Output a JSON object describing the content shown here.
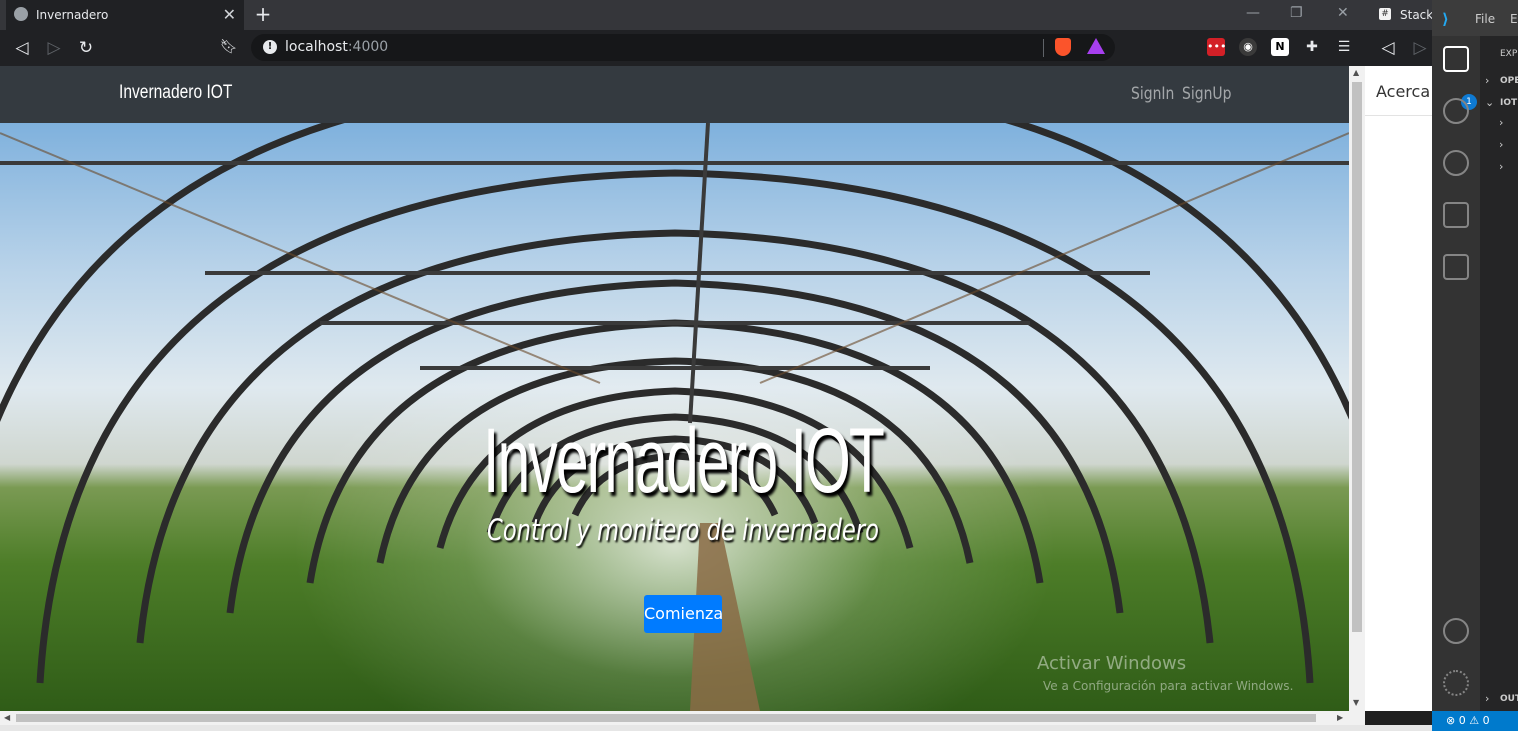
{
  "browser": {
    "tab_title": "Invernadero",
    "other_tab": "Stackl",
    "url_host": "localhost",
    "url_port": ":4000"
  },
  "vscode": {
    "menu": [
      "File",
      "E"
    ],
    "badge": "1",
    "sidebar": {
      "explorer": "EXP",
      "open_editors": "OPE",
      "project": "IOT",
      "outline": "OUT"
    },
    "status": "⊗ 0 ⚠ 0"
  },
  "side_panel": {
    "title": "Acerca"
  },
  "site": {
    "brand": "Invernadero IOT",
    "nav": [
      "SignIn",
      "SignUp"
    ],
    "hero_title": "Invernadero IOT",
    "hero_subtitle": "Control y monitero de invernadero",
    "cta": "Comienza"
  },
  "overlay": {
    "line1": "Activar Windows",
    "line2": "Ve a Configuración para activar Windows."
  },
  "colors": {
    "navbar": "#343a40",
    "cta": "#007bff",
    "vscode_status": "#007acc"
  }
}
